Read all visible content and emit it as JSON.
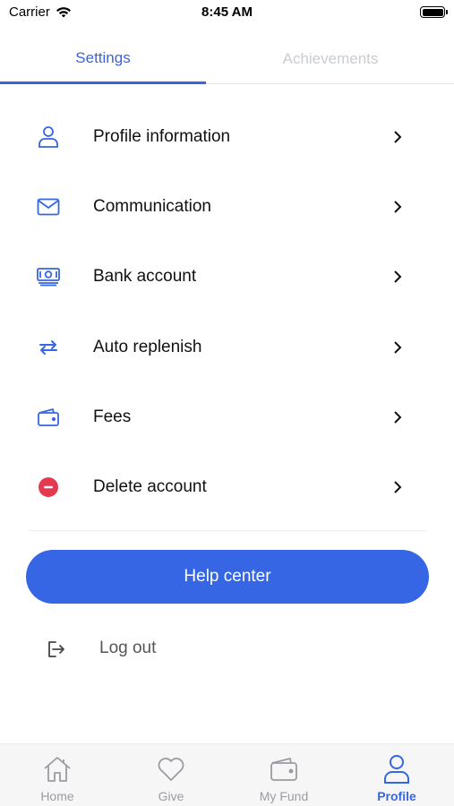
{
  "status_bar": {
    "carrier": "Carrier",
    "time": "8:45 AM"
  },
  "tabs": [
    {
      "label": "Settings",
      "active": true
    },
    {
      "label": "Achievements",
      "active": false
    }
  ],
  "menu": [
    {
      "label": "Profile information",
      "icon": "user-icon"
    },
    {
      "label": "Communication",
      "icon": "envelope-icon"
    },
    {
      "label": "Bank account",
      "icon": "cash-icon"
    },
    {
      "label": "Auto replenish",
      "icon": "repeat-icon"
    },
    {
      "label": "Fees",
      "icon": "wallet-icon"
    },
    {
      "label": "Delete account",
      "icon": "minus-circle-icon"
    }
  ],
  "help_center": {
    "label": "Help center"
  },
  "logout": {
    "label": "Log out",
    "icon": "logout-icon"
  },
  "bottom_nav": [
    {
      "label": "Home",
      "icon": "home-icon",
      "active": false
    },
    {
      "label": "Give",
      "icon": "heart-icon",
      "active": false
    },
    {
      "label": "My Fund",
      "icon": "wallet-icon",
      "active": false
    },
    {
      "label": "Profile",
      "icon": "user-icon",
      "active": true
    }
  ],
  "colors": {
    "accent": "#3666e3",
    "danger": "#e53950",
    "inactive": "#9a9ca2"
  }
}
